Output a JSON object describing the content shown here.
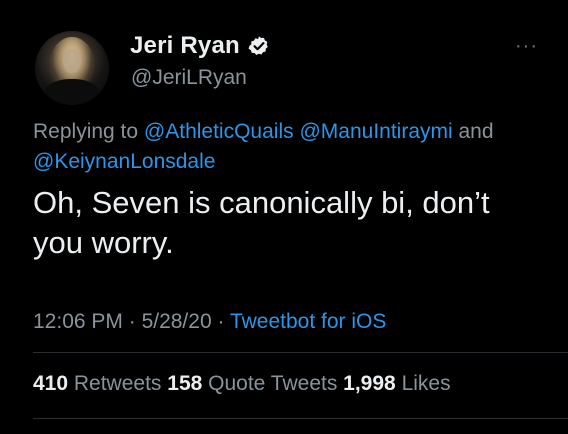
{
  "author": {
    "display_name": "Jeri Ryan",
    "handle": "@JeriLRyan",
    "verified": true
  },
  "more_label": "···",
  "reply": {
    "prefix": "Replying to ",
    "mentions": [
      "@AthleticQuails",
      "@ManuIntiraymi",
      "@KeiynanLonsdale"
    ],
    "conjunction": " and "
  },
  "text": "Oh, Seven is canonically bi, don’t you worry.",
  "meta": {
    "time": "12:06 PM",
    "separator1": " · ",
    "date": "5/28/20",
    "separator2": " · ",
    "source": "Tweetbot for iOS"
  },
  "stats": {
    "retweets_count": "410",
    "retweets_label": " Retweets ",
    "quote_count": "158",
    "quote_label": " Quote Tweets ",
    "likes_count": "1,998",
    "likes_label": " Likes"
  },
  "colors": {
    "background": "#000000",
    "text": "#eceff1",
    "secondary": "#8a939c",
    "link": "#2c95e8",
    "verified": "#eceff1"
  }
}
